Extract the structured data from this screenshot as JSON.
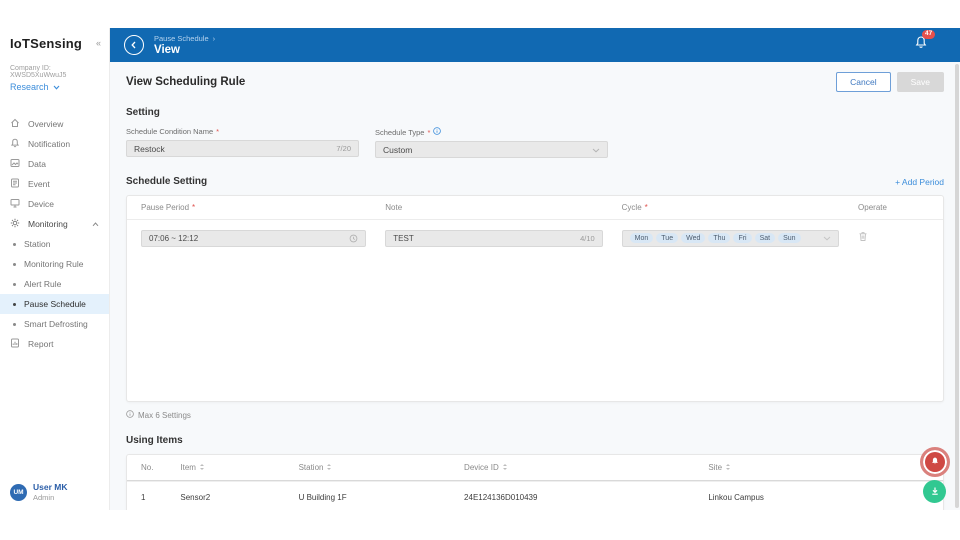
{
  "marks": {
    "required": "*",
    "collapse": "«",
    "breadcrumb_sep": "›"
  },
  "colors": {
    "header_blue": "#1169b2",
    "accent_blue": "#3d8edb",
    "badge_red": "#e5504c",
    "fab_red": "#cf4944",
    "fab_green": "#31c891",
    "active_item_bg": "#e4f1fc"
  },
  "sidebar": {
    "logo": "IoTSensing",
    "company_id": "Company ID: XWSD5XuWwuJ5",
    "workspace": "Research",
    "items": [
      {
        "label": "Overview",
        "icon": "home-icon"
      },
      {
        "label": "Notification",
        "icon": "bell-icon"
      },
      {
        "label": "Data",
        "icon": "image-icon"
      },
      {
        "label": "Event",
        "icon": "document-icon"
      },
      {
        "label": "Device",
        "icon": "monitor-icon"
      },
      {
        "label": "Monitoring",
        "icon": "gear-icon"
      }
    ],
    "sub_items": [
      "Station",
      "Monitoring Rule",
      "Alert Rule",
      "Pause Schedule",
      "Smart Defrosting"
    ],
    "active_sub_item": "Pause Schedule",
    "report_label": "Report",
    "user": {
      "initials": "UM",
      "name": "User MK",
      "role": "Admin"
    }
  },
  "header": {
    "breadcrumb": "Pause Schedule",
    "title": "View",
    "notification_count": "47"
  },
  "page": {
    "title": "View Scheduling Rule",
    "cancel_label": "Cancel",
    "save_label": "Save"
  },
  "setting": {
    "heading": "Setting",
    "name_label": "Schedule Condition Name",
    "name_value": "Restock",
    "name_counter": "7/20",
    "type_label": "Schedule Type",
    "type_value": "Custom"
  },
  "schedule": {
    "heading": "Schedule Setting",
    "add_label": "+ Add Period",
    "columns": {
      "period": "Pause Period",
      "note": "Note",
      "cycle": "Cycle",
      "operate": "Operate"
    },
    "row": {
      "period": "07:06 ~ 12:12",
      "note": "TEST",
      "note_counter": "4/10",
      "days": [
        "Mon",
        "Tue",
        "Wed",
        "Thu",
        "Fri",
        "Sat",
        "Sun"
      ]
    },
    "max_note": "Max 6 Settings"
  },
  "using_items": {
    "heading": "Using Items",
    "columns": [
      "No.",
      "Item",
      "Station",
      "Device ID",
      "Site"
    ],
    "rows": [
      [
        "1",
        "Sensor2",
        "U Building 1F",
        "24E124136D010439",
        "Linkou Campus"
      ]
    ]
  }
}
